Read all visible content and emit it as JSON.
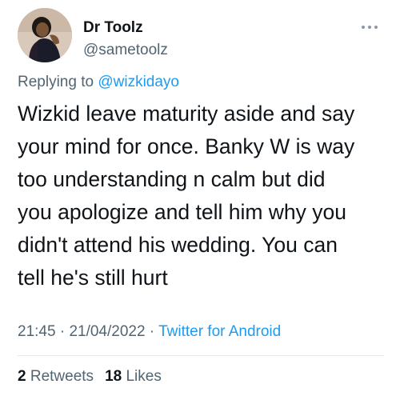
{
  "author": {
    "display_name": "Dr Toolz",
    "handle": "@sametoolz"
  },
  "more_icon": "more-horizontal-icon",
  "reply": {
    "prefix": "Replying to ",
    "to": "@wizkidayo"
  },
  "tweet": {
    "lines": [
      "Wizkid leave maturity aside and say",
      "your mind for once. Banky W is way",
      "too understanding n calm but did",
      "you apologize and tell him why you",
      "didn't attend his wedding. You can",
      "tell he's still hurt"
    ]
  },
  "meta": {
    "time": "21:45",
    "separator": " · ",
    "date": "21/04/2022",
    "source": "Twitter for Android"
  },
  "stats": {
    "retweets_count": "2",
    "retweets_label": " Retweets",
    "likes_count": "18",
    "likes_label": " Likes"
  },
  "colors": {
    "text": "#0f1419",
    "secondary": "#536471",
    "accent": "#1d9bf0"
  }
}
